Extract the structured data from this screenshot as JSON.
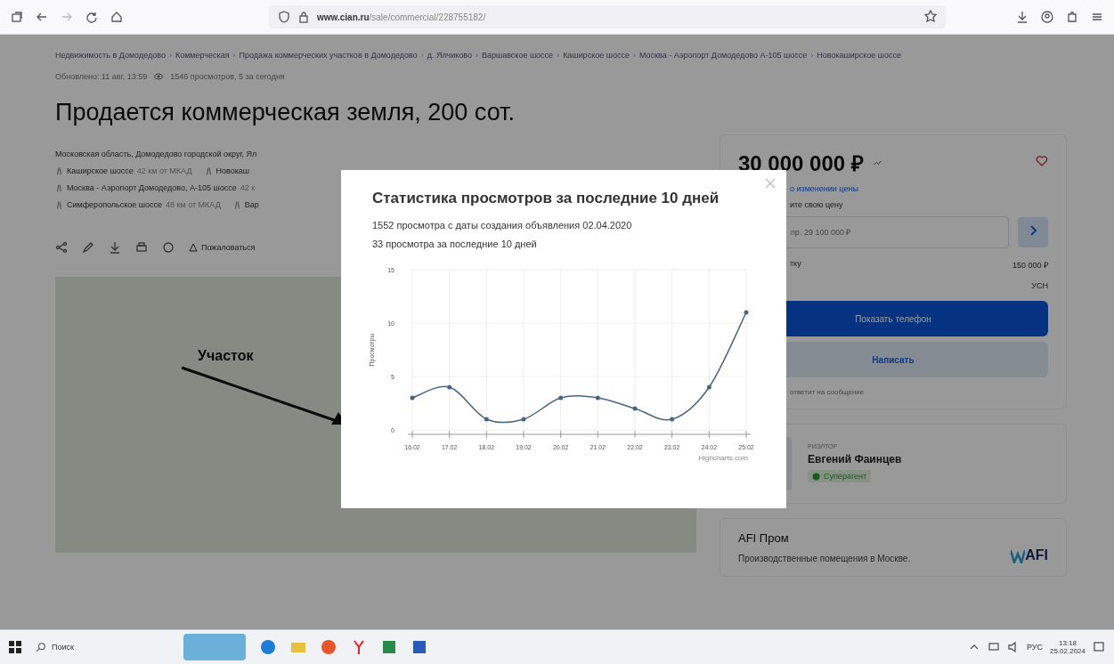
{
  "browser": {
    "url_domain": "www.cian.ru",
    "url_path": "/sale/commercial/228755182/"
  },
  "breadcrumb_separator": "›",
  "breadcrumbs": [
    "Недвижимость в Домодедово",
    "Коммерческая",
    "Продажа коммерческих участков в Домодедово",
    "д. Ялчиково",
    "Варшавское шоссе",
    "Каширское шоссе",
    "Москва - Аэропорт Домодедово А-105 шоссе",
    "Новокаширское шоссе"
  ],
  "meta": {
    "updated": "Обновлено: 11 авг, 13:59",
    "views": "1546 просмотров, 5 за сегодня"
  },
  "listing": {
    "title": "Продается коммерческая земля, 200 сот.",
    "address": "Московская область, Домодедово городской округ, Ял",
    "highways": [
      [
        {
          "name": "Каширское шоссе",
          "distance": "42 км от МКАД"
        },
        {
          "name": "Новокаш"
        }
      ],
      [
        {
          "name": "Москва - Аэропорт Домодедово, А-105 шоссе",
          "distance": "42 к"
        }
      ],
      [
        {
          "name": "Симферопольское шоссе",
          "distance": "48 км от МКАД"
        },
        {
          "name": "Вар"
        }
      ]
    ],
    "complain": "Пожаловаться",
    "map_label": "Участок"
  },
  "sidebar": {
    "price": "30 000 000 ₽",
    "price_watch": "о изменении цены",
    "offer_label": "ите свою цену",
    "offer_placeholder": "пр. 29 100 000 ₽",
    "rows": [
      {
        "label": "тку",
        "value": "150 000 ₽"
      },
      {
        "label": "",
        "value": "УСН"
      }
    ],
    "show_phone": "Показать телефон",
    "write": "Написать",
    "reply_note": "ответит на сообщение",
    "agent": {
      "role": "РИЭЛТОР",
      "name": "Евгений Фаинцев",
      "badge": "Суперагент"
    },
    "promo": {
      "title": "AFI Пром",
      "text": "Производственные помещения в Москве.",
      "logo": "AFI"
    }
  },
  "modal": {
    "title": "Статистика просмотров за последние 10 дней",
    "total": "1552 просмотра с даты создания объявления 02.04.2020",
    "recent": "33 просмотра за последние 10 дней",
    "chart_data": {
      "type": "line",
      "ylabel": "Просмотры",
      "categories": [
        "16.02",
        "17.02",
        "18.02",
        "19.02",
        "20.02",
        "21.02",
        "22.02",
        "23.02",
        "24.02",
        "25.02"
      ],
      "series": [
        {
          "color": "#4a6580",
          "values": [
            3,
            4,
            1,
            1,
            3,
            3,
            2,
            1,
            4,
            11
          ]
        }
      ],
      "grid": true,
      "ylim": [
        0,
        15
      ],
      "yticks": [
        0,
        5,
        10,
        15
      ]
    },
    "credit": "Highcharts.com"
  },
  "taskbar": {
    "search": "Поиск",
    "lang": "РУС",
    "time": "13:18",
    "date": "25.02.2024"
  }
}
